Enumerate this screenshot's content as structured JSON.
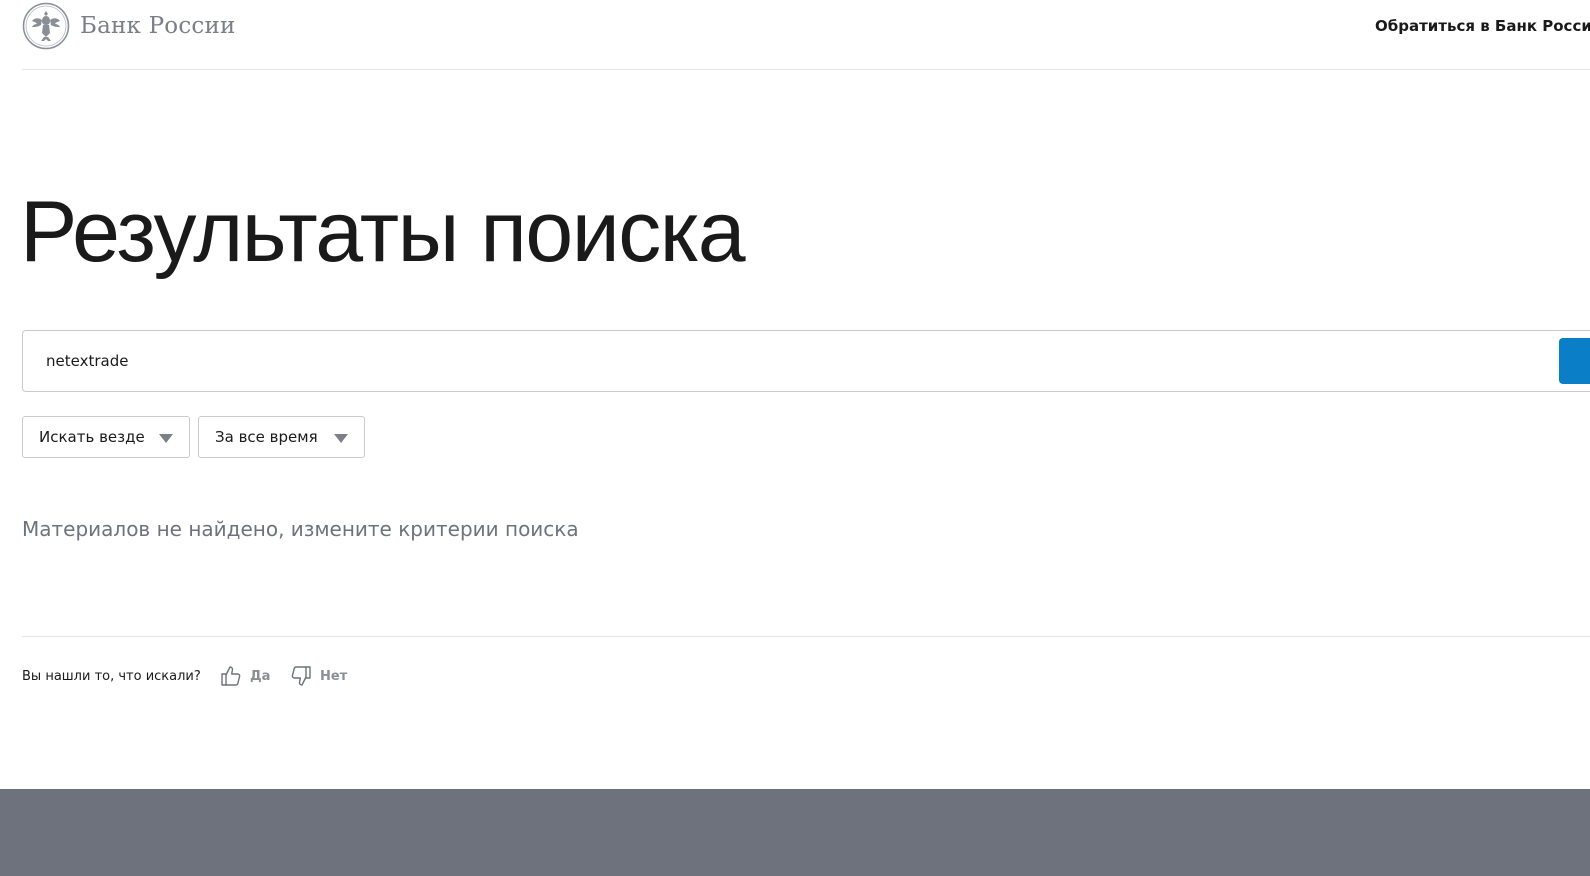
{
  "header": {
    "logo_text": "Банк России",
    "contact_link": "Обратиться в Банк России"
  },
  "main": {
    "title": "Результаты поиска",
    "search": {
      "value": "netextrade"
    },
    "filters": [
      {
        "label": "Искать везде"
      },
      {
        "label": "За все время"
      }
    ],
    "empty_message": "Материалов не найдено, измените критерии поиска"
  },
  "feedback": {
    "question": "Вы нашли то, что искали?",
    "yes_label": "Да",
    "no_label": "Нет"
  },
  "colors": {
    "accent": "#0a7fc7",
    "footer": "#6d727d",
    "muted_text": "#6e737b"
  },
  "icons": [
    "bank-emblem-icon",
    "thumbs-up-icon",
    "thumbs-down-icon",
    "chevron-down-icon"
  ]
}
